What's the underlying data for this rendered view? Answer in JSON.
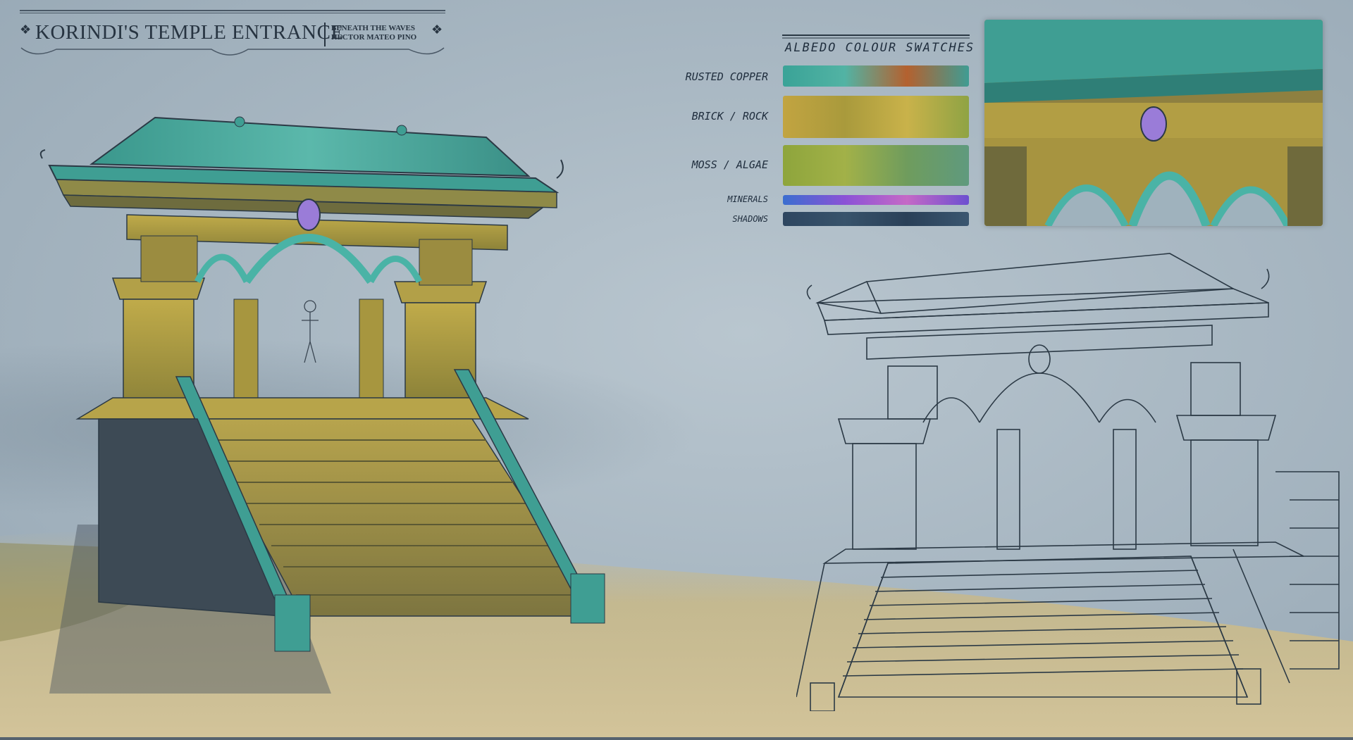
{
  "header": {
    "title": "KORINDI'S TEMPLE ENTRANCE",
    "subtitle_line1": "BENEATH THE WAVES",
    "subtitle_line2": "HECTOR MATEO PINO"
  },
  "swatches": {
    "heading": "ALBEDO COLOUR SWATCHES",
    "items": [
      {
        "label": "RUSTED COPPER",
        "colors": [
          "#3aa397",
          "#52b3a4",
          "#b4612f",
          "#3f9c93"
        ]
      },
      {
        "label": "BRICK / ROCK",
        "colors": [
          "#c2a441",
          "#a99a3c",
          "#c9b24a",
          "#8fa344"
        ]
      },
      {
        "label": "MOSS / ALGAE",
        "colors": [
          "#8ea53c",
          "#a2b148",
          "#6f9c5d",
          "#5f9a7e"
        ]
      },
      {
        "label": "MINERALS",
        "colors": [
          "#3b6ed0",
          "#8b52d6",
          "#c569c6",
          "#6c4fd0"
        ]
      },
      {
        "label": "SHADOWS",
        "colors": [
          "#2e4660",
          "#38536b",
          "#2a4058",
          "#3a5670"
        ]
      }
    ]
  },
  "palette": {
    "copper": "#3f9e93",
    "copper_light": "#5cbdb0",
    "stone": "#b5a34a",
    "stone_dark": "#6a6a3c",
    "shadow": "#3d4a55",
    "sand": "#c8b98a",
    "line": "#2b3945"
  }
}
